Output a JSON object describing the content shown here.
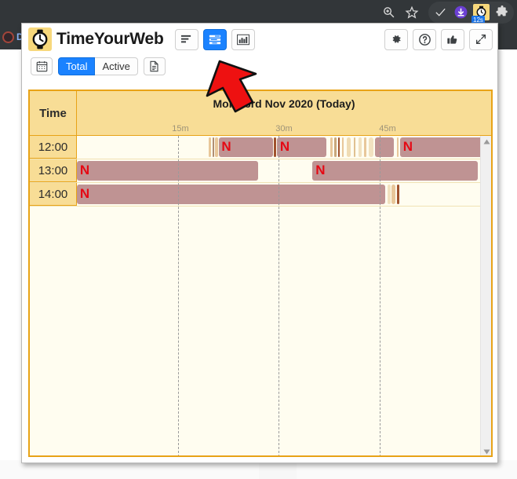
{
  "browser": {
    "icons": [
      {
        "name": "zoom-in-icon",
        "glyph": "search-plus"
      },
      {
        "name": "bookmark-star-icon",
        "glyph": "star"
      },
      {
        "name": "checkmark-icon",
        "glyph": "check"
      },
      {
        "name": "download-icon",
        "glyph": "download"
      },
      {
        "name": "timeyourweb-extension-icon",
        "glyph": "watch"
      },
      {
        "name": "extensions-puzzle-icon",
        "glyph": "puzzle"
      }
    ],
    "extension_badge": "12s",
    "behind_page_label": "D"
  },
  "popup": {
    "brand": "TimeYourWeb",
    "header_buttons": [
      {
        "name": "sort-list-view-button",
        "label": "",
        "active": false
      },
      {
        "name": "timeline-view-button",
        "label": "",
        "active": true
      },
      {
        "name": "bar-chart-view-button",
        "label": "",
        "active": false
      }
    ],
    "header_right_buttons": [
      {
        "name": "settings-button",
        "label": ""
      },
      {
        "name": "help-button",
        "label": ""
      },
      {
        "name": "thumbs-up-button",
        "label": ""
      },
      {
        "name": "expand-button",
        "label": ""
      }
    ],
    "subbar": {
      "calendar_button": "",
      "total_label": "Total",
      "active_label": "Active",
      "report_button": ""
    }
  },
  "timeline": {
    "time_column_header": "Time",
    "day_header": "Mon 23rd Nov 2020 (Today)",
    "tick_labels": [
      "15m",
      "30m",
      "45m"
    ],
    "tick_positions_pct": [
      25,
      50,
      75
    ],
    "rows": [
      {
        "time": "12:00",
        "segments": [
          {
            "start_pct": 31.9,
            "width_pct": 0.5,
            "color": "#e8c79a",
            "site": "other"
          },
          {
            "start_pct": 32.7,
            "width_pct": 0.4,
            "color": "#b08d72",
            "site": "other"
          },
          {
            "start_pct": 33.4,
            "width_pct": 0.6,
            "color": "#e8c79a",
            "site": "other"
          },
          {
            "start_pct": 34.2,
            "width_pct": 13.1,
            "color": "#bf9393",
            "site": "netflix",
            "favicon": "N"
          },
          {
            "start_pct": 47.6,
            "width_pct": 0.5,
            "color": "#a0522d",
            "site": "other"
          },
          {
            "start_pct": 48.3,
            "width_pct": 12.0,
            "color": "#bf9393",
            "site": "netflix",
            "favicon": "N"
          },
          {
            "start_pct": 61.2,
            "width_pct": 0.5,
            "color": "#e8c79a",
            "site": "other"
          },
          {
            "start_pct": 62.2,
            "width_pct": 0.4,
            "color": "#c9a87c",
            "site": "other"
          },
          {
            "start_pct": 63.0,
            "width_pct": 0.5,
            "color": "#a0522d",
            "site": "other"
          },
          {
            "start_pct": 64.0,
            "width_pct": 0.4,
            "color": "#e8c79a",
            "site": "other"
          },
          {
            "start_pct": 65.2,
            "width_pct": 0.9,
            "color": "#f0dcb4",
            "site": "other"
          },
          {
            "start_pct": 66.8,
            "width_pct": 0.5,
            "color": "#e0c190",
            "site": "other"
          },
          {
            "start_pct": 67.9,
            "width_pct": 0.8,
            "color": "#f2e2c0",
            "site": "other"
          },
          {
            "start_pct": 69.3,
            "width_pct": 0.6,
            "color": "#e8c79a",
            "site": "other"
          },
          {
            "start_pct": 70.5,
            "width_pct": 1.0,
            "color": "#f2e2c0",
            "site": "other"
          },
          {
            "start_pct": 72.0,
            "width_pct": 4.6,
            "color": "#bf9393",
            "site": "netflix"
          },
          {
            "start_pct": 77.2,
            "width_pct": 0.4,
            "color": "#e8c79a",
            "site": "other"
          },
          {
            "start_pct": 78.0,
            "width_pct": 21.6,
            "color": "#bf9393",
            "site": "netflix",
            "favicon": "N"
          }
        ]
      },
      {
        "time": "13:00",
        "segments": [
          {
            "start_pct": 0.0,
            "width_pct": 43.8,
            "color": "#bf9393",
            "site": "netflix",
            "favicon": "N"
          },
          {
            "start_pct": 56.9,
            "width_pct": 39.9,
            "color": "#bf9393",
            "site": "netflix",
            "favicon": "N"
          }
        ]
      },
      {
        "time": "14:00",
        "segments": [
          {
            "start_pct": 0.0,
            "width_pct": 74.5,
            "color": "#bf9393",
            "site": "netflix",
            "favicon": "N"
          },
          {
            "start_pct": 75.0,
            "width_pct": 0.7,
            "color": "#f2e2c0",
            "site": "other"
          },
          {
            "start_pct": 76.0,
            "width_pct": 0.9,
            "color": "#e8c79a",
            "site": "other"
          },
          {
            "start_pct": 77.3,
            "width_pct": 0.5,
            "color": "#a0522d",
            "site": "other"
          }
        ]
      }
    ]
  },
  "colors": {
    "accent_blue": "#1a82ff",
    "card_border": "#e8a317",
    "header_bg": "#f8dd96",
    "card_bg": "#fffdf0",
    "netflix_bar": "#bf9393",
    "netflix_red": "#e50914",
    "arrow_red": "#ee1111"
  }
}
